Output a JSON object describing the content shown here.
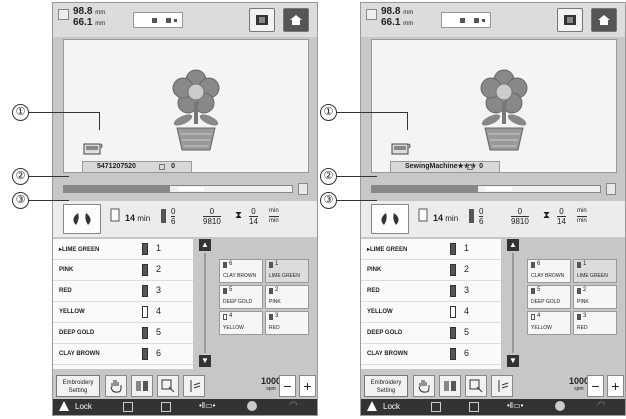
{
  "panels": [
    {
      "size": {
        "width": "98.8",
        "height": "66.1",
        "unit": "mm"
      },
      "machine_name": "5471207520",
      "count": "0",
      "stats": {
        "time": "14",
        "time_unit": "min",
        "stitch_color_num": "0",
        "stitch_color_den": "6",
        "stitch_cur": "0",
        "stitch_total": "9810",
        "time_cur": "0",
        "time_total": "14",
        "min_unit": "min"
      },
      "color_list": [
        {
          "name": "LIME GREEN",
          "num": "1",
          "spool": "dark",
          "marker": "▸"
        },
        {
          "name": "PINK",
          "num": "2",
          "spool": "dark",
          "marker": ""
        },
        {
          "name": "RED",
          "num": "3",
          "spool": "dark",
          "marker": ""
        },
        {
          "name": "YELLOW",
          "num": "4",
          "spool": "light",
          "marker": ""
        },
        {
          "name": "DEEP GOLD",
          "num": "5",
          "spool": "dark",
          "marker": ""
        },
        {
          "name": "CLAY BROWN",
          "num": "6",
          "spool": "dark",
          "marker": ""
        }
      ],
      "thread_grid": [
        {
          "num": "6",
          "name": "CLAY BROWN",
          "spool": "dark",
          "selected": false
        },
        {
          "num": "1",
          "name": "LIME GREEN",
          "spool": "dark",
          "selected": true
        },
        {
          "num": "5",
          "name": "DEEP GOLD",
          "spool": "dark",
          "selected": false
        },
        {
          "num": "2",
          "name": "PINK",
          "spool": "dark",
          "selected": false
        },
        {
          "num": "4",
          "name": "YELLOW",
          "spool": "light",
          "selected": false
        },
        {
          "num": "3",
          "name": "RED",
          "spool": "dark",
          "selected": false
        }
      ],
      "embroidery_setting": "Embroidery Setting",
      "spm_value": "1000",
      "spm_unit": "spm",
      "plus": "+",
      "minus": "−",
      "lock_label": "Lock"
    },
    {
      "size": {
        "width": "98.8",
        "height": "66.1",
        "unit": "mm"
      },
      "machine_name": "SewingMachine★★★",
      "count": "0",
      "stats": {
        "time": "14",
        "time_unit": "min",
        "stitch_color_num": "0",
        "stitch_color_den": "6",
        "stitch_cur": "0",
        "stitch_total": "9810",
        "time_cur": "0",
        "time_total": "14",
        "min_unit": "min"
      },
      "color_list": [
        {
          "name": "LIME GREEN",
          "num": "1",
          "spool": "dark",
          "marker": "▸"
        },
        {
          "name": "PINK",
          "num": "2",
          "spool": "dark",
          "marker": ""
        },
        {
          "name": "RED",
          "num": "3",
          "spool": "dark",
          "marker": ""
        },
        {
          "name": "YELLOW",
          "num": "4",
          "spool": "light",
          "marker": ""
        },
        {
          "name": "DEEP GOLD",
          "num": "5",
          "spool": "dark",
          "marker": ""
        },
        {
          "name": "CLAY BROWN",
          "num": "6",
          "spool": "dark",
          "marker": ""
        }
      ],
      "thread_grid": [
        {
          "num": "6",
          "name": "CLAY BROWN",
          "spool": "dark",
          "selected": false
        },
        {
          "num": "1",
          "name": "LIME GREEN",
          "spool": "dark",
          "selected": true
        },
        {
          "num": "5",
          "name": "DEEP GOLD",
          "spool": "dark",
          "selected": false
        },
        {
          "num": "2",
          "name": "PINK",
          "spool": "dark",
          "selected": false
        },
        {
          "num": "4",
          "name": "YELLOW",
          "spool": "light",
          "selected": false
        },
        {
          "num": "3",
          "name": "RED",
          "spool": "dark",
          "selected": false
        }
      ],
      "embroidery_setting": "Embroidery Setting",
      "spm_value": "1000",
      "spm_unit": "spm",
      "plus": "+",
      "minus": "−",
      "lock_label": "Lock"
    }
  ],
  "callouts": [
    "①",
    "②",
    "③"
  ],
  "progress_fraction": 0.47
}
